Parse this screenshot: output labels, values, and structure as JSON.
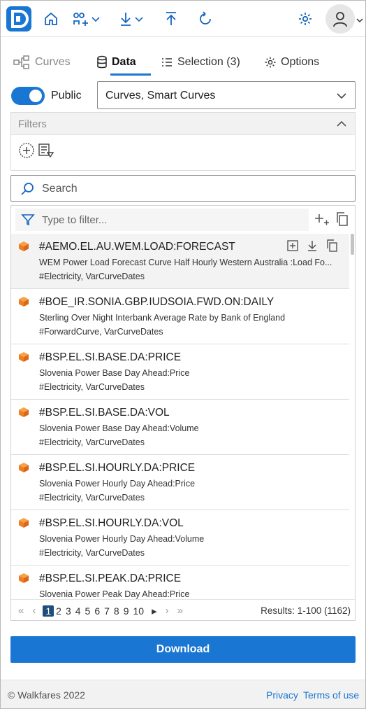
{
  "tabs": [
    {
      "label": "Curves",
      "icon": "flow-icon"
    },
    {
      "label": "Data",
      "icon": "database-icon"
    },
    {
      "label": "Selection (3)",
      "icon": "list-icon"
    },
    {
      "label": "Options",
      "icon": "gear-icon"
    }
  ],
  "public_toggle": {
    "label": "Public",
    "on": true
  },
  "source_select": {
    "value": "Curves, Smart Curves"
  },
  "filters": {
    "title": "Filters"
  },
  "search": {
    "placeholder": "Search"
  },
  "list_filter": {
    "placeholder": "Type to filter..."
  },
  "rows": [
    {
      "title": "#AEMO.EL.AU.WEM.LOAD:FORECAST",
      "desc": "WEM Power Load Forecast Curve Half Hourly Western Australia :Load Fo...",
      "tags": "#Electricity, VarCurveDates"
    },
    {
      "title": "#BOE_IR.SONIA.GBP.IUDSOIA.FWD.ON:DAILY",
      "desc": "Sterling Over Night Interbank Average Rate by Bank of England",
      "tags": "#ForwardCurve, VarCurveDates"
    },
    {
      "title": "#BSP.EL.SI.BASE.DA:PRICE",
      "desc": "Slovenia Power Base Day Ahead:Price",
      "tags": "#Electricity, VarCurveDates"
    },
    {
      "title": "#BSP.EL.SI.BASE.DA:VOL",
      "desc": "Slovenia Power Base Day Ahead:Volume",
      "tags": "#Electricity, VarCurveDates"
    },
    {
      "title": "#BSP.EL.SI.HOURLY.DA:PRICE",
      "desc": "Slovenia Power Hourly Day Ahead:Price",
      "tags": "#Electricity, VarCurveDates"
    },
    {
      "title": "#BSP.EL.SI.HOURLY.DA:VOL",
      "desc": "Slovenia Power Hourly Day Ahead:Volume",
      "tags": "#Electricity, VarCurveDates"
    },
    {
      "title": "#BSP.EL.SI.PEAK.DA:PRICE",
      "desc": "Slovenia Power Peak Day Ahead:Price",
      "tags": ""
    }
  ],
  "pager": {
    "first": "«",
    "prev": "‹",
    "play": "▸",
    "next": "›",
    "last": "»",
    "pages": [
      "1",
      "2",
      "3",
      "4",
      "5",
      "6",
      "7",
      "8",
      "9",
      "10"
    ],
    "current": "1",
    "results": "Results: 1-100 (1162)"
  },
  "download_label": "Download",
  "footer": {
    "copyright": "© Walkfares 2022",
    "privacy": "Privacy",
    "terms": "Terms of use"
  },
  "colors": {
    "accent": "#1976d2",
    "cube": "#f07d1f",
    "pager_current": "#1f4e79"
  }
}
